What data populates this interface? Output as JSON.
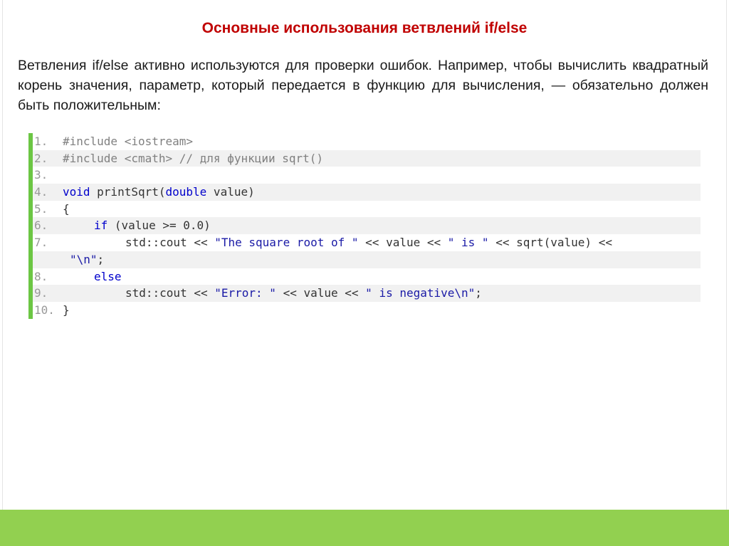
{
  "slide": {
    "title": "Основные использования ветвлений if/else",
    "intro": "Ветвления if/else активно используются для проверки ошибок. Например, чтобы вычислить квадратный корень значения, параметр, который передается в функцию для вычисления, — обязательно должен быть положительным:"
  },
  "code": {
    "lines": [
      {
        "num": "1.",
        "indent": 0,
        "tokens": [
          {
            "t": "pre",
            "v": "#include <iostream>"
          }
        ]
      },
      {
        "num": "2.",
        "indent": 0,
        "tokens": [
          {
            "t": "pre",
            "v": "#include <cmath>"
          },
          {
            "t": "cmt",
            "v": " // для функции sqrt()"
          }
        ]
      },
      {
        "num": "3.",
        "indent": 0,
        "tokens": []
      },
      {
        "num": "4.",
        "indent": 0,
        "tokens": [
          {
            "t": "kw",
            "v": "void"
          },
          {
            "t": "txt",
            "v": " printSqrt("
          },
          {
            "t": "kw",
            "v": "double"
          },
          {
            "t": "txt",
            "v": " value)"
          }
        ]
      },
      {
        "num": "5.",
        "indent": 0,
        "tokens": [
          {
            "t": "txt",
            "v": "{"
          }
        ]
      },
      {
        "num": "6.",
        "indent": 1,
        "tokens": [
          {
            "t": "kw",
            "v": "if"
          },
          {
            "t": "txt",
            "v": " (value >= 0.0)"
          }
        ]
      },
      {
        "num": "7.",
        "indent": 2,
        "tokens": [
          {
            "t": "txt",
            "v": "std::cout << "
          },
          {
            "t": "str",
            "v": "\"The square root of \""
          },
          {
            "t": "txt",
            "v": " << value << "
          },
          {
            "t": "str",
            "v": "\" is \""
          },
          {
            "t": "txt",
            "v": " << sqrt(value) <<"
          }
        ]
      },
      {
        "num": "",
        "indent": 0,
        "cont": true,
        "tokens": [
          {
            "t": "str",
            "v": "\"\\n\""
          },
          {
            "t": "txt",
            "v": ";"
          }
        ]
      },
      {
        "num": "8.",
        "indent": 1,
        "tokens": [
          {
            "t": "kw",
            "v": "else"
          }
        ]
      },
      {
        "num": "9.",
        "indent": 2,
        "tokens": [
          {
            "t": "txt",
            "v": "std::cout << "
          },
          {
            "t": "str",
            "v": "\"Error: \""
          },
          {
            "t": "txt",
            "v": " << value << "
          },
          {
            "t": "str",
            "v": "\" is negative\\n\""
          },
          {
            "t": "txt",
            "v": ";"
          }
        ]
      },
      {
        "num": "10.",
        "indent": 0,
        "tokens": [
          {
            "t": "txt",
            "v": "}"
          }
        ]
      }
    ]
  },
  "colors": {
    "title": "#c00000",
    "code_border": "#6cc644",
    "footer": "#92d050"
  }
}
